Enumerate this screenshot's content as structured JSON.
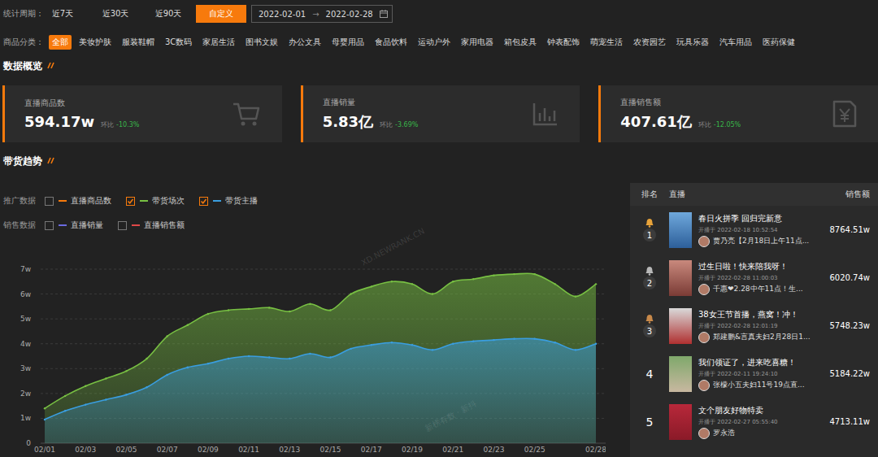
{
  "period": {
    "label": "统计周期：",
    "tabs": [
      {
        "label": "近7天",
        "selected": false
      },
      {
        "label": "近30天",
        "selected": false
      },
      {
        "label": "近90天",
        "selected": false
      },
      {
        "label": "自定义",
        "selected": true
      }
    ],
    "date_range": {
      "start": "2022-02-01",
      "separator": "→",
      "end": "2022-02-28"
    }
  },
  "categories": {
    "label": "商品分类：",
    "items": [
      {
        "label": "全部",
        "selected": true
      },
      {
        "label": "美妆护肤",
        "selected": false
      },
      {
        "label": "服装鞋帽",
        "selected": false
      },
      {
        "label": "3C数码",
        "selected": false
      },
      {
        "label": "家居生活",
        "selected": false
      },
      {
        "label": "图书文娱",
        "selected": false
      },
      {
        "label": "办公文具",
        "selected": false
      },
      {
        "label": "母婴用品",
        "selected": false
      },
      {
        "label": "食品饮料",
        "selected": false
      },
      {
        "label": "运动户外",
        "selected": false
      },
      {
        "label": "家用电器",
        "selected": false
      },
      {
        "label": "箱包皮具",
        "selected": false
      },
      {
        "label": "钟表配饰",
        "selected": false
      },
      {
        "label": "萌宠生活",
        "selected": false
      },
      {
        "label": "农资园艺",
        "selected": false
      },
      {
        "label": "玩具乐器",
        "selected": false
      },
      {
        "label": "汽车用品",
        "selected": false
      },
      {
        "label": "医药保健",
        "selected": false
      }
    ]
  },
  "overview": {
    "title": "数据概览",
    "cards": [
      {
        "label": "直播商品数",
        "value": "594.17w",
        "change_label": "环比",
        "change": "-10.3%"
      },
      {
        "label": "直播销量",
        "value": "5.83亿",
        "change_label": "环比",
        "change": "-3.69%"
      },
      {
        "label": "直播销售额",
        "value": "407.61亿",
        "change_label": "环比",
        "change": "-12.05%"
      }
    ]
  },
  "trend": {
    "title": "带货趋势",
    "legend": [
      {
        "label": "推广数据",
        "items": [
          {
            "label": "直播商品数",
            "checked": false,
            "color": "#f77a0c"
          },
          {
            "label": "带货场次",
            "checked": true,
            "color": "#78c043",
            "values": [
              1.4,
              1.9,
              2.3,
              2.6,
              2.9,
              3.4,
              4.3,
              4.75,
              5.2,
              5.35,
              5.4,
              5.45,
              5.3,
              5.6,
              5.35,
              6.0,
              6.3,
              6.5,
              6.4,
              6.0,
              6.5,
              6.6,
              6.75,
              6.8,
              6.8,
              6.4,
              5.9,
              6.4
            ]
          },
          {
            "label": "带货主播",
            "checked": true,
            "color": "#3a9ee0",
            "values": [
              0.95,
              1.3,
              1.55,
              1.75,
              1.95,
              2.25,
              2.75,
              3.05,
              3.2,
              3.4,
              3.5,
              3.45,
              3.4,
              3.6,
              3.45,
              3.8,
              3.95,
              4.05,
              3.95,
              3.75,
              4.0,
              4.1,
              4.15,
              4.2,
              4.2,
              4.05,
              3.75,
              4.0
            ]
          }
        ]
      },
      {
        "label": "销售数据",
        "items": [
          {
            "label": "直播销量",
            "checked": false,
            "color": "#6a6ae0"
          },
          {
            "label": "直播销售额",
            "checked": false,
            "color": "#e04848"
          }
        ]
      }
    ],
    "chart": {
      "y_ticks": [
        "0",
        "1w",
        "2w",
        "3w",
        "4w",
        "5w",
        "6w",
        "7w"
      ],
      "x_ticks": [
        "02/01",
        "02/03",
        "02/05",
        "02/07",
        "02/09",
        "02/11",
        "02/13",
        "02/15",
        "02/17",
        "02/19",
        "02/21",
        "02/23",
        "02/25",
        "02/28"
      ]
    }
  },
  "ranking": {
    "columns": [
      "排名",
      "直播",
      "销售额"
    ],
    "rows": [
      {
        "rank": "1",
        "kind": "medal",
        "color": "#e8a33a",
        "title": "春日火拼季 回归完新意",
        "start_time": "开播于 2022-02-18 10:52:54",
        "anchor": "贾乃亮【2月18日上午11点...",
        "sales": "8764.51w"
      },
      {
        "rank": "2",
        "kind": "medal",
        "color": "#b8b8b8",
        "title": "过生日啦！快来陪我呀！",
        "start_time": "开播于 2022-02-28 11:00:03",
        "anchor": "千惠❤2.28中午11点！生...",
        "sales": "6020.74w"
      },
      {
        "rank": "3",
        "kind": "medal",
        "color": "#c8894a",
        "title": "38女王节首播，燕窝！冲！",
        "start_time": "开播于 2022-02-28 12:01:19",
        "anchor": "郑建鹏&言真夫妇2月28日1...",
        "sales": "5748.23w"
      },
      {
        "rank": "4",
        "kind": "plain",
        "title": "我们领证了，进来吃喜糖！",
        "start_time": "开播于 2022-02-11 19:24:10",
        "anchor": "张檬小五夫妇11号19点直...",
        "sales": "5184.22w"
      },
      {
        "rank": "5",
        "kind": "plain",
        "title": "文个朋友好物特卖",
        "start_time": "开播于 2022-02-27 05:55:40",
        "anchor": "罗永浩",
        "sales": "4713.11w"
      }
    ]
  },
  "watermarks": [
    "XD.NEWRANK.CN",
    "新榜有数 · 新抖"
  ]
}
